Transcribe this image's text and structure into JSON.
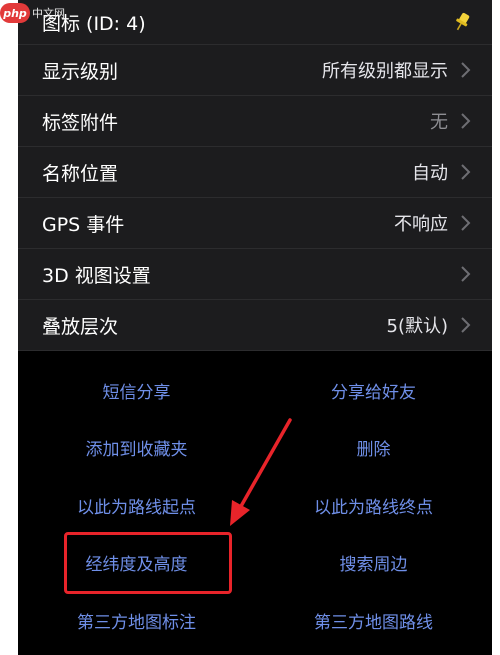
{
  "watermark": {
    "logo": "php",
    "text": "中文网"
  },
  "list": {
    "rows": [
      {
        "label": "图标 (ID: 4)",
        "value": "",
        "icon": "pin-icon"
      },
      {
        "label": "显示级别",
        "value": "所有级别都显示"
      },
      {
        "label": "标签附件",
        "value": "无"
      },
      {
        "label": "名称位置",
        "value": "自动"
      },
      {
        "label": "GPS 事件",
        "value": "不响应"
      },
      {
        "label": "3D 视图设置",
        "value": ""
      },
      {
        "label": "叠放层次",
        "value": "5(默认)"
      }
    ]
  },
  "actions": [
    {
      "label": "短信分享"
    },
    {
      "label": "分享给好友"
    },
    {
      "label": "添加到收藏夹"
    },
    {
      "label": "删除"
    },
    {
      "label": "以此为路线起点"
    },
    {
      "label": "以此为路线终点"
    },
    {
      "label": "经纬度及高度"
    },
    {
      "label": "搜索周边"
    },
    {
      "label": "第三方地图标注"
    },
    {
      "label": "第三方地图路线"
    }
  ],
  "colors": {
    "row_bg": "#1c1c1e",
    "action_text": "#6f8fe8",
    "annotation": "#e8242a",
    "pin": "#f2d23a"
  }
}
